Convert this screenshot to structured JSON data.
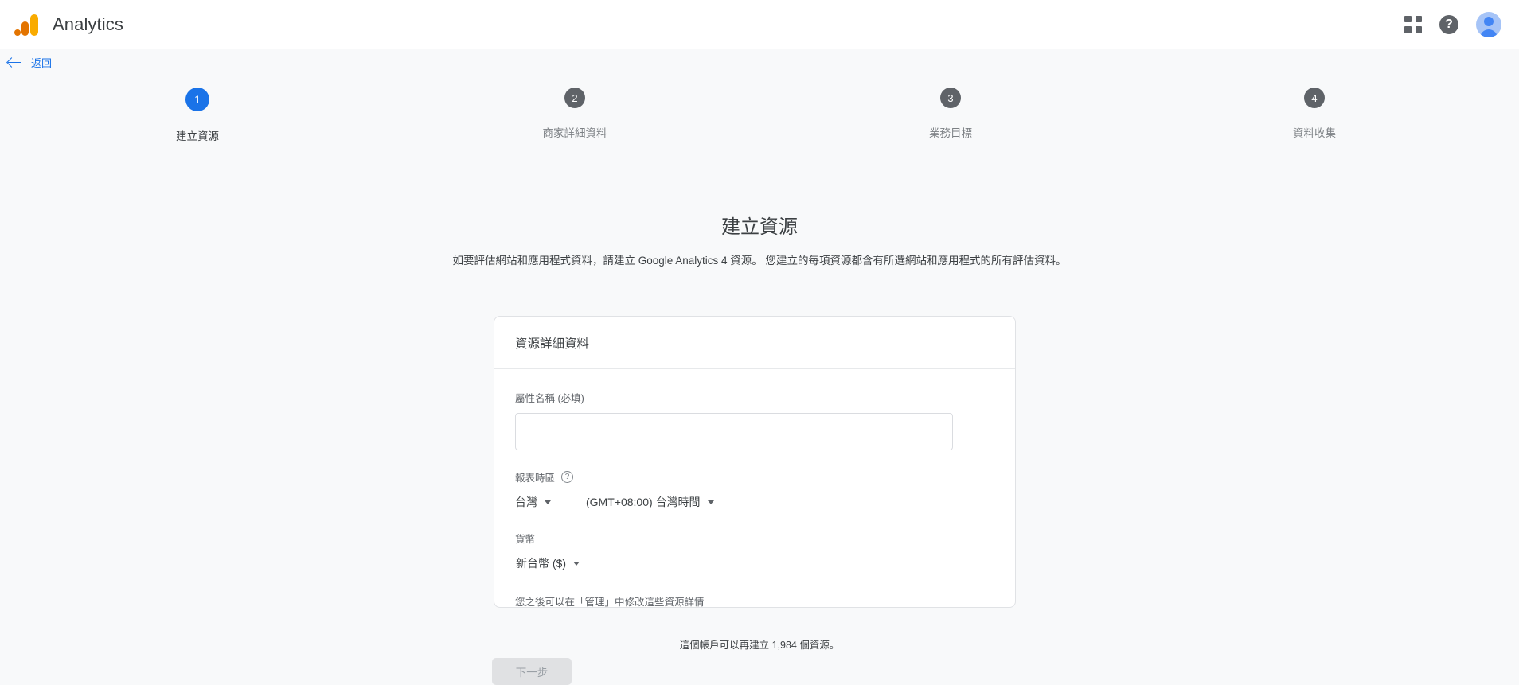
{
  "appbar": {
    "brand_title": "Analytics",
    "apps_icon": "apps-grid-icon",
    "help_icon": "?",
    "avatar_icon": "account-avatar"
  },
  "backbar": {
    "label": "返回"
  },
  "stepper": {
    "steps": [
      {
        "number": "1",
        "label": "建立資源",
        "state": "active"
      },
      {
        "number": "2",
        "label": "商家詳細資料",
        "state": "inactive"
      },
      {
        "number": "3",
        "label": "業務目標",
        "state": "inactive"
      },
      {
        "number": "4",
        "label": "資料收集",
        "state": "inactive"
      }
    ]
  },
  "page": {
    "heading": "建立資源",
    "description": "如要評估網站和應用程式資料，請建立 Google Analytics 4 資源。 您建立的每項資源都含有所選網站和應用程式的所有評估資料。"
  },
  "card": {
    "title": "資源詳細資料",
    "property_name": {
      "label": "屬性名稱 (必填)",
      "value": "",
      "placeholder": ""
    },
    "reporting_time_zone": {
      "label": "報表時區",
      "help_icon": "?",
      "country_value": "台灣",
      "timezone_value": "(GMT+08:00) 台灣時間"
    },
    "currency": {
      "label": "貨幣",
      "value": "新台幣 ($)"
    },
    "hint": "您之後可以在「管理」中修改這些資源詳情"
  },
  "footnote": "這個帳戶可以再建立 1,984 個資源。",
  "submit_button": {
    "label": "下一步",
    "state": "disabled"
  },
  "colors": {
    "accent_blue": "#1a73e8",
    "page_background": "#f8f9fa",
    "card_background": "#ffffff",
    "text_primary": "#3c4043",
    "text_secondary": "#5f6368",
    "logo_amber": "#f9ab00",
    "logo_orange": "#e37400"
  }
}
